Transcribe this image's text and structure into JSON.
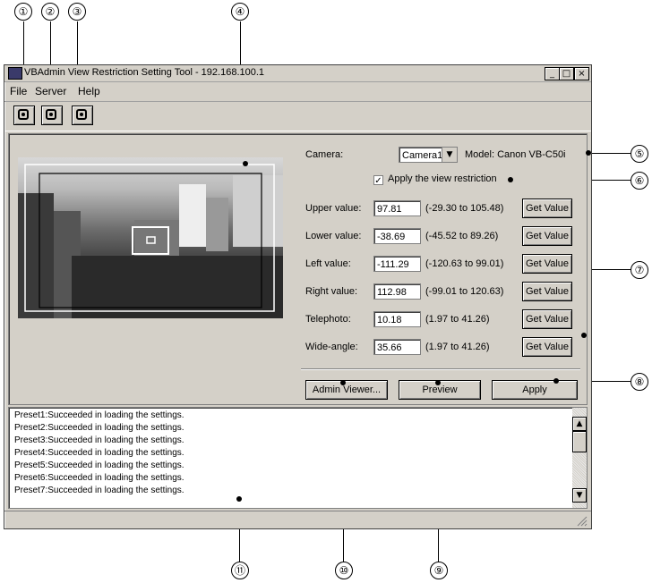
{
  "callouts": [
    "①",
    "②",
    "③",
    "④",
    "⑤",
    "⑥",
    "⑦",
    "⑧",
    "⑨",
    "⑩",
    "⑪"
  ],
  "window": {
    "title": "VBAdmin View Restriction Setting Tool - 192.168.100.1",
    "minimize": "_",
    "maximize": "□",
    "close": "×"
  },
  "menu": {
    "file": "File",
    "server": "Server",
    "help": "Help"
  },
  "toolbar": [
    "camera-icon",
    "camera-icon",
    "camera-icon"
  ],
  "settings": {
    "camera_label": "Camera:",
    "camera_value": "Camera1",
    "model_text": "Model: Canon VB-C50i",
    "apply_restriction_label": "Apply the view restriction",
    "apply_restriction_checked": "✓",
    "rows": [
      {
        "label": "Upper value:",
        "value": "97.81",
        "range": "(-29.30 to 105.48)",
        "button": "Get Value"
      },
      {
        "label": "Lower value:",
        "value": "-38.69",
        "range": "(-45.52 to 89.26)",
        "button": "Get Value"
      },
      {
        "label": "Left value:",
        "value": "-111.29",
        "range": "(-120.63 to 99.01)",
        "button": "Get Value"
      },
      {
        "label": "Right value:",
        "value": "112.98",
        "range": "(-99.01 to 120.63)",
        "button": "Get Value"
      },
      {
        "label": "Telephoto:",
        "value": "10.18",
        "range": "(1.97 to 41.26)",
        "button": "Get Value"
      },
      {
        "label": "Wide-angle:",
        "value": "35.66",
        "range": "(1.97 to 41.26)",
        "button": "Get Value"
      }
    ]
  },
  "actions": {
    "admin_viewer": "Admin Viewer...",
    "preview": "Preview",
    "apply": "Apply"
  },
  "log": [
    "Preset1:Succeeded in loading the settings.",
    "Preset2:Succeeded in loading the settings.",
    "Preset3:Succeeded in loading the settings.",
    "Preset4:Succeeded in loading the settings.",
    "Preset5:Succeeded in loading the settings.",
    "Preset6:Succeeded in loading the settings.",
    "Preset7:Succeeded in loading the settings."
  ],
  "scroll": {
    "up": "▲",
    "down": "▼"
  },
  "dropdown_arrow": "▼"
}
